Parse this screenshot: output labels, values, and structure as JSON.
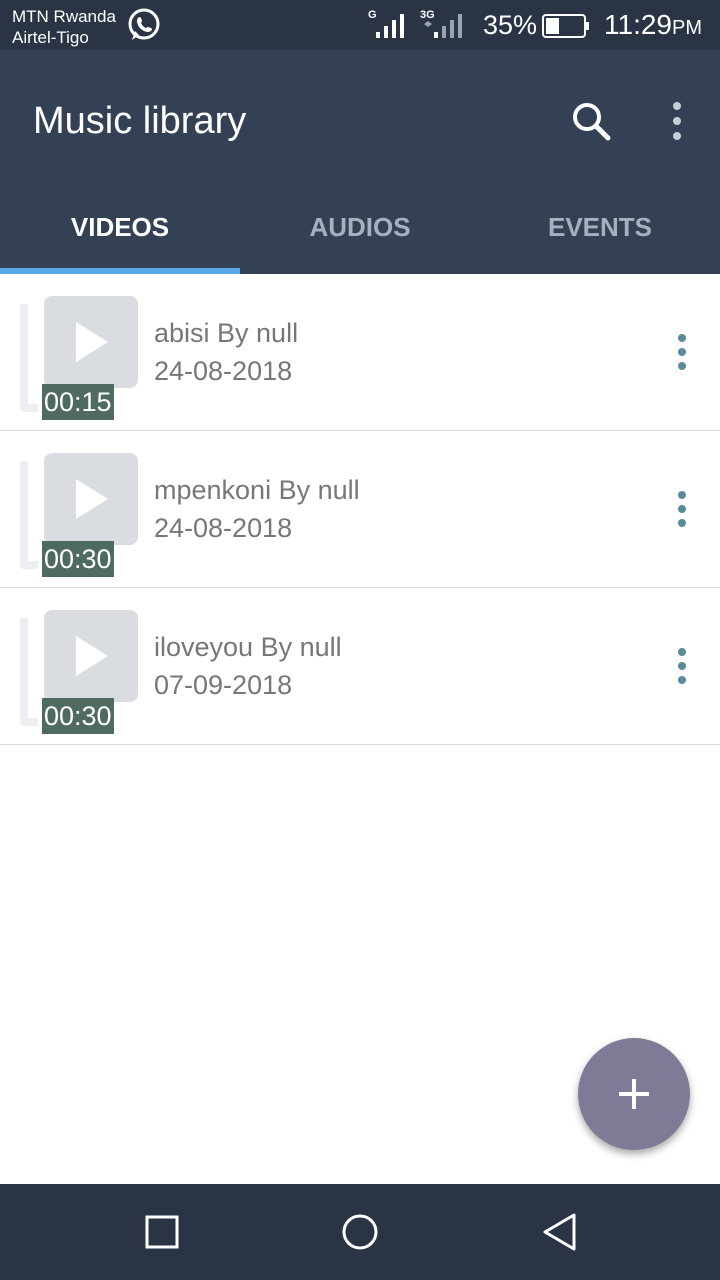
{
  "status_bar": {
    "carrier_1": "MTN Rwanda",
    "carrier_2": "Airtel-Tigo",
    "network_1": "G",
    "network_2": "3G",
    "battery": "35%",
    "time": "11:29",
    "ampm": "PM",
    "icons": [
      "whatsapp-icon",
      "signal-icon",
      "battery-icon"
    ]
  },
  "app_bar": {
    "title": "Music library",
    "icons": [
      "search-icon",
      "more-vert-icon"
    ]
  },
  "tabs": [
    {
      "label": "VIDEOS",
      "active": true
    },
    {
      "label": "AUDIOS",
      "active": false
    },
    {
      "label": "EVENTS",
      "active": false
    }
  ],
  "videos": [
    {
      "title": "abisi By null",
      "date": "24-08-2018",
      "duration": "00:15"
    },
    {
      "title": "mpenkoni By null",
      "date": "24-08-2018",
      "duration": "00:30"
    },
    {
      "title": "iloveyou By null",
      "date": "07-09-2018",
      "duration": "00:30"
    }
  ],
  "fab": {
    "icon": "plus-icon"
  },
  "colors": {
    "app_bar": "#344155",
    "status_bar": "#2a3445",
    "tab_indicator": "#58a6e8",
    "fab": "#7d7b96",
    "duration_badge": "#4f6b5f",
    "more_dots": "#5b8a99"
  }
}
